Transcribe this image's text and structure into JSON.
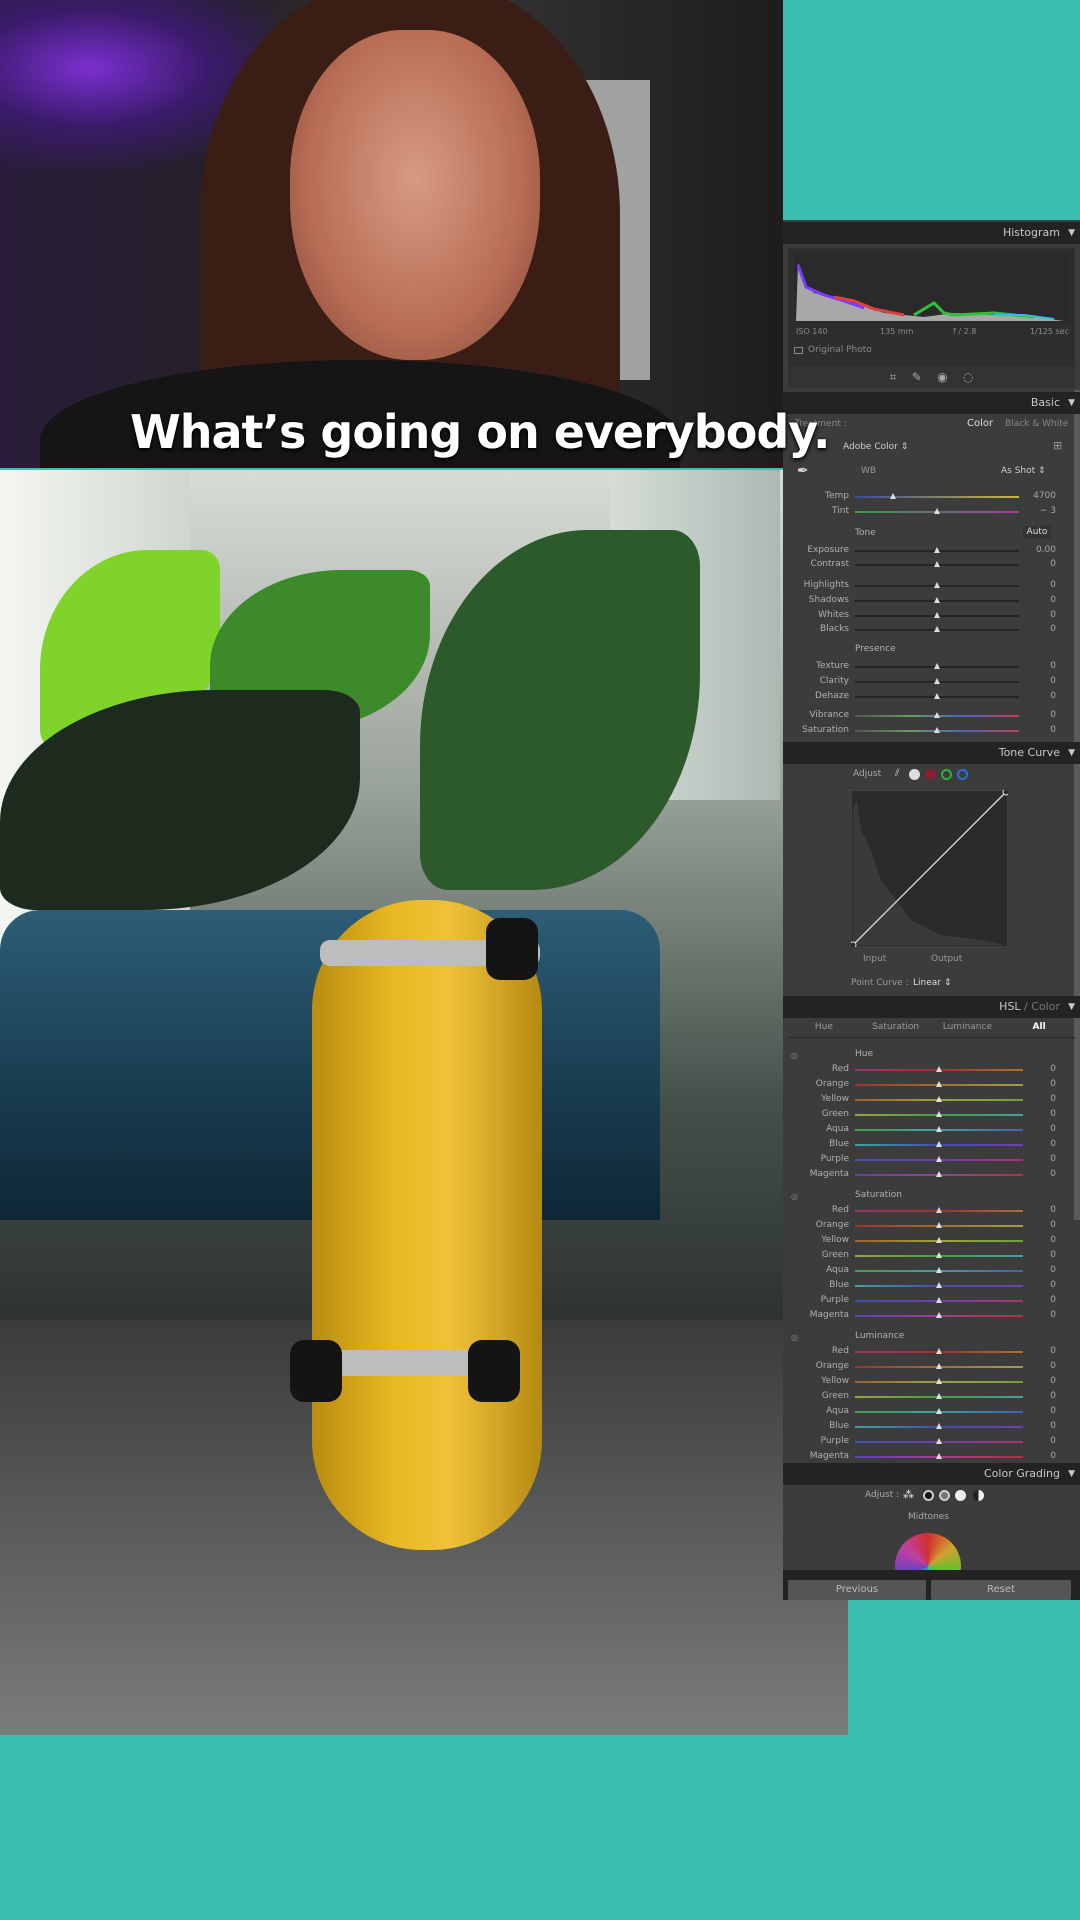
{
  "video": {
    "caption": "What’s going on everybody."
  },
  "panel": {
    "histogram": {
      "title": "Histogram",
      "iso": "ISO 140",
      "focal": "135 mm",
      "aperture": "f / 2.8",
      "shutter": "1/125 sec",
      "original_photo": "Original Photo"
    },
    "tools": [
      "crop-icon",
      "healing-brush-icon",
      "red-eye-icon",
      "masking-icon"
    ],
    "basic": {
      "title": "Basic",
      "treatment_label": "Treatment :",
      "treatment_color": "Color",
      "treatment_bw": "Black & White",
      "profile": "Adobe Color",
      "wb_label": "WB",
      "wb_value": "As Shot",
      "wb_sliders": [
        {
          "label": "Temp",
          "value": "4700",
          "pos": 0.23
        },
        {
          "label": "Tint",
          "value": "− 3",
          "pos": 0.5
        }
      ],
      "tone_label": "Tone",
      "auto": "Auto",
      "tone_sliders": [
        {
          "label": "Exposure",
          "value": "0.00",
          "pos": 0.5
        },
        {
          "label": "Contrast",
          "value": "0",
          "pos": 0.5
        },
        {
          "label": "Highlights",
          "value": "0",
          "pos": 0.5
        },
        {
          "label": "Shadows",
          "value": "0",
          "pos": 0.5
        },
        {
          "label": "Whites",
          "value": "0",
          "pos": 0.5
        },
        {
          "label": "Blacks",
          "value": "0",
          "pos": 0.5
        }
      ],
      "presence_label": "Presence",
      "presence_sliders": [
        {
          "label": "Texture",
          "value": "0",
          "pos": 0.5
        },
        {
          "label": "Clarity",
          "value": "0",
          "pos": 0.5
        },
        {
          "label": "Dehaze",
          "value": "0",
          "pos": 0.5
        },
        {
          "label": "Vibrance",
          "value": "0",
          "pos": 0.5
        },
        {
          "label": "Saturation",
          "value": "0",
          "pos": 0.5
        }
      ]
    },
    "tone_curve": {
      "title": "Tone Curve",
      "adjust": "Adjust",
      "input": "Input",
      "output": "Output",
      "point_curve_label": "Point Curve :",
      "point_curve_value": "Linear"
    },
    "hsl": {
      "title": "HSL",
      "title2": "Color",
      "tabs": [
        "Hue",
        "Saturation",
        "Luminance",
        "All"
      ],
      "active_tab": "All",
      "groups": [
        {
          "label": "Hue",
          "rows": [
            {
              "label": "Red",
              "value": "0"
            },
            {
              "label": "Orange",
              "value": "0"
            },
            {
              "label": "Yellow",
              "value": "0"
            },
            {
              "label": "Green",
              "value": "0"
            },
            {
              "label": "Aqua",
              "value": "0"
            },
            {
              "label": "Blue",
              "value": "0"
            },
            {
              "label": "Purple",
              "value": "0"
            },
            {
              "label": "Magenta",
              "value": "0"
            }
          ]
        },
        {
          "label": "Saturation",
          "rows": [
            {
              "label": "Red",
              "value": "0"
            },
            {
              "label": "Orange",
              "value": "0"
            },
            {
              "label": "Yellow",
              "value": "0"
            },
            {
              "label": "Green",
              "value": "0"
            },
            {
              "label": "Aqua",
              "value": "0"
            },
            {
              "label": "Blue",
              "value": "0"
            },
            {
              "label": "Purple",
              "value": "0"
            },
            {
              "label": "Magenta",
              "value": "0"
            }
          ]
        },
        {
          "label": "Luminance",
          "rows": [
            {
              "label": "Red",
              "value": "0"
            },
            {
              "label": "Orange",
              "value": "0"
            },
            {
              "label": "Yellow",
              "value": "0"
            },
            {
              "label": "Green",
              "value": "0"
            },
            {
              "label": "Aqua",
              "value": "0"
            },
            {
              "label": "Blue",
              "value": "0"
            },
            {
              "label": "Purple",
              "value": "0"
            },
            {
              "label": "Magenta",
              "value": "0"
            }
          ]
        }
      ]
    },
    "color_grading": {
      "title": "Color Grading",
      "adjust": "Adjust :",
      "midtones": "Midtones"
    },
    "previous": "Previous",
    "reset": "Reset"
  },
  "colors": {
    "background": "#3bbfb0",
    "panel": "#3c3c3c",
    "panel_header": "#232323"
  }
}
